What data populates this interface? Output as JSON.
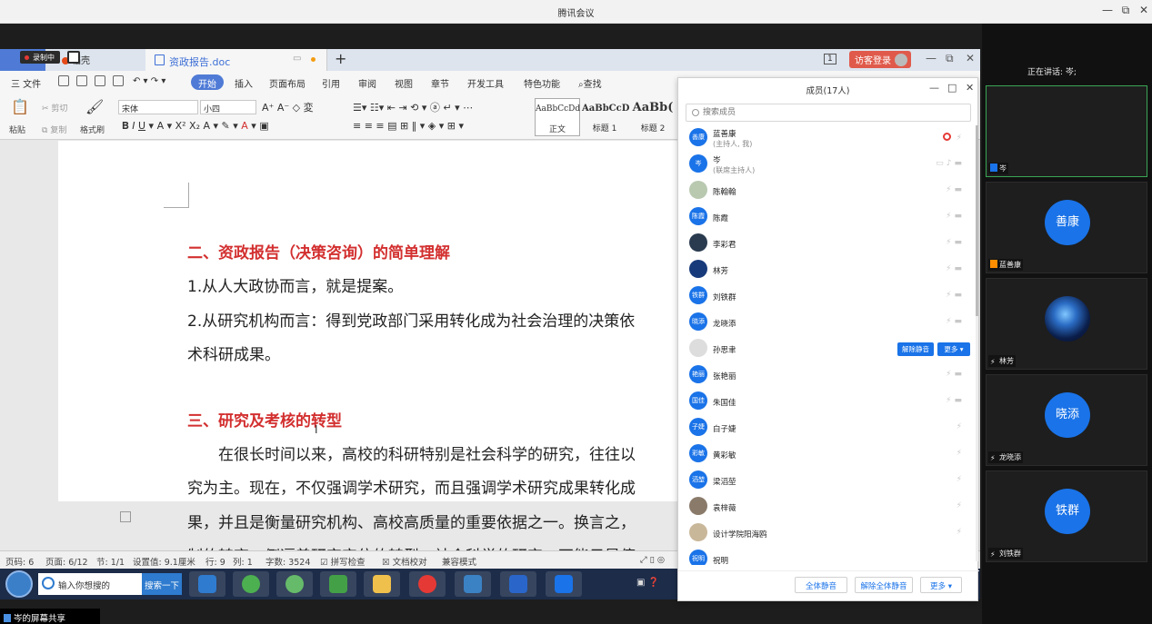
{
  "window": {
    "title": "腾讯会议"
  },
  "recording": {
    "label": "录制中"
  },
  "wps": {
    "tab_home_partial": "首",
    "tab_shell": "稻壳",
    "tab_doc": "资政报告.doc",
    "page_indicator": "1",
    "visitor_login": "访客登录",
    "menu": [
      "三 文件",
      "开始",
      "插入",
      "页面布局",
      "引用",
      "审阅",
      "视图",
      "章节",
      "开发工具",
      "特色功能",
      "查找"
    ],
    "ribbon": {
      "paste": "粘贴",
      "cut": "剪切",
      "copy": "复制",
      "format_painter": "格式刷",
      "font": "宋体",
      "size": "小四",
      "styles": [
        {
          "sample": "AaBbCcDd",
          "name": "正文"
        },
        {
          "sample": "AaBbCcD",
          "name": "标题 1"
        },
        {
          "sample": "AaBb(",
          "name": "标题 2"
        }
      ]
    }
  },
  "document": {
    "lines": [
      {
        "text": "二、资政报告（决策咨询）的简单理解",
        "heading": true
      },
      {
        "text": "1.从人大政协而言，就是提案。",
        "heading": false
      },
      {
        "text": "2.从研究机构而言：得到党政部门采用转化成为社会治理的决策依",
        "heading": false
      },
      {
        "text": "术科研成果。",
        "heading": false
      },
      {
        "text": "三、研究及考核的转型",
        "heading": true
      },
      {
        "text": "　　在很长时间以来，高校的科研特别是社会科学的研究，往往以",
        "heading": false
      },
      {
        "text": "究为主。现在，不仅强调学术研究，而且强调学术研究成果转化成",
        "heading": false
      },
      {
        "text": "果，并且是衡量研究机构、高校高质量的重要依据之一。换言之，",
        "heading": false
      },
      {
        "text": "制的转变，倒逼着研究定位的转型，社会科学的研究，不能只是停",
        "heading": false
      }
    ]
  },
  "statusbar": [
    "页码: 6",
    "页面: 6/12",
    "节: 1/1",
    "设置值: 9.1厘米",
    "行: 9",
    "列: 1",
    "字数: 3524",
    "拼写检查",
    "文档校对",
    "兼容模式"
  ],
  "taskbar": {
    "search_placeholder": "输入你想搜的",
    "search_button": "搜索一下"
  },
  "share": {
    "label": "岑的屏幕共享"
  },
  "members": {
    "title": "成员(17人)",
    "search_placeholder": "搜索成员",
    "list": [
      {
        "avatar": "善康",
        "name": "蓝善康",
        "role": "(主持人, 我)",
        "status": "recording"
      },
      {
        "avatar": "岑",
        "name": "岑",
        "role": "(联席主持人)",
        "status": "host"
      },
      {
        "avatar": "",
        "name": "陈翰翰",
        "role": "",
        "status": "muted"
      },
      {
        "avatar": "陈霞",
        "name": "陈霞",
        "role": "",
        "status": "muted"
      },
      {
        "avatar": "",
        "name": "李彩君",
        "role": "",
        "status": "muted"
      },
      {
        "avatar": "",
        "name": "林芳",
        "role": "",
        "status": "muted"
      },
      {
        "avatar": "铁群",
        "name": "刘铁群",
        "role": "",
        "status": "muted"
      },
      {
        "avatar": "晓添",
        "name": "龙晓添",
        "role": "",
        "status": "muted"
      },
      {
        "avatar": "",
        "name": "孙思聿",
        "role": "",
        "status": "hover"
      },
      {
        "avatar": "艳丽",
        "name": "张艳丽",
        "role": "",
        "status": "muted"
      },
      {
        "avatar": "国佳",
        "name": "朱国佳",
        "role": "",
        "status": "muted"
      },
      {
        "avatar": "子婕",
        "name": "白子婕",
        "role": "",
        "status": "mic"
      },
      {
        "avatar": "彩敏",
        "name": "黄彩敏",
        "role": "",
        "status": "mic"
      },
      {
        "avatar": "滔堃",
        "name": "梁滔堃",
        "role": "",
        "status": "mic"
      },
      {
        "avatar": "",
        "name": "袁梓薇",
        "role": "",
        "status": "mic"
      },
      {
        "avatar": "",
        "name": "设计学院阳海鸥",
        "role": "",
        "status": "mic"
      },
      {
        "avatar": "祝明",
        "name": "祝明",
        "role": "",
        "status": "none"
      }
    ],
    "unmute_btn": "解除静音",
    "more_btn": "更多 ▾",
    "footer": {
      "mute_all": "全体静音",
      "unmute_all": "解除全体静音",
      "more": "更多 ▾"
    }
  },
  "video": {
    "speaking_label": "正在讲话: 岑;",
    "tiles": [
      {
        "circle": "",
        "name": "岑",
        "active": true
      },
      {
        "circle": "善康",
        "name": "蓝善康",
        "active": false
      },
      {
        "circle": "",
        "name": "林芳",
        "active": false
      },
      {
        "circle": "晓添",
        "name": "龙晓添",
        "active": false
      },
      {
        "circle": "铁群",
        "name": "刘铁群",
        "active": false
      }
    ]
  },
  "colors": {
    "accent": "#1a73e8",
    "wps_blue": "#4f7bd6",
    "heading_red": "#d32f2f",
    "active_green": "#3aa655"
  }
}
